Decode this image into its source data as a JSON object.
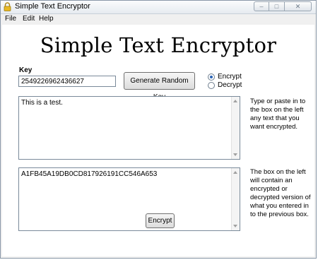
{
  "window": {
    "title": "Simple Text Encryptor",
    "controls": {
      "minimize": "–",
      "maximize": "□",
      "close": "✕"
    }
  },
  "menu": [
    "File",
    "Edit",
    "Help"
  ],
  "main": {
    "heading": "Simple Text Encryptor",
    "key_label": "Key",
    "key_value": "2549226962436627",
    "generate_button": "Generate Random Key",
    "mode_options": [
      {
        "label": "Encrypt",
        "selected": true
      },
      {
        "label": "Decrypt",
        "selected": false
      }
    ],
    "input_text": "This is a test.",
    "input_hint": "Type or paste in to the box on the left any text that you want encrypted.",
    "output_text": "A1FB45A19DB0CD817926191CC546A653",
    "output_hint": "The box on the left will contain an encrypted or decrypted version of what you entered in to the previous box.",
    "action_button": "Encrypt"
  },
  "icons": {
    "app": "lock-icon"
  },
  "colors": {
    "accent": "#2a63b5",
    "border": "#7a8a9a"
  }
}
